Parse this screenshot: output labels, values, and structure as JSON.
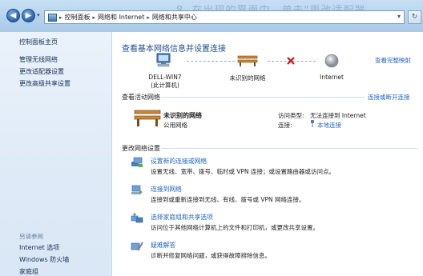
{
  "window": {
    "background_overlay_text": "8. 在出现的界面中，单击\"更改适配器"
  },
  "address_bar": {
    "segments": [
      "控制面板",
      "网络和 Internet",
      "网络和共享中心"
    ],
    "separator": "▸",
    "end_glyph": "▾",
    "refresh_glyph": "↻"
  },
  "nav": {
    "back_glyph": "◀",
    "forward_glyph": "▶",
    "drop_glyph": "▾"
  },
  "sidebar": {
    "items": [
      {
        "label": "控制面板主页"
      },
      {
        "label": "管理无线网络"
      },
      {
        "label": "更改适配器设置"
      },
      {
        "label": "更改高级共享设置"
      }
    ],
    "see_also_heading": "另请参阅",
    "see_also_items": [
      {
        "label": "Internet 选项"
      },
      {
        "label": "Windows 防火墙"
      },
      {
        "label": "家庭组"
      }
    ]
  },
  "main": {
    "title": "查看基本网络信息并设置连接",
    "view_full_map": "查看完整映射",
    "map_nodes": [
      {
        "label": "DELL-WIN7",
        "sublabel": "(此计算机)"
      },
      {
        "label": "未识别的网络",
        "sublabel": ""
      },
      {
        "label": "Internet",
        "sublabel": ""
      }
    ],
    "active_networks_label": "查看活动网络",
    "connect_disconnect": "连接或断开连接",
    "network": {
      "name": "未识别的网络",
      "type": "公用网络",
      "access_type_label": "访问类型:",
      "access_type_value": "无法连接到 Internet",
      "connections_label": "连接:",
      "connections_value": "本地连接"
    },
    "change_settings_label": "更改网络设置",
    "tasks": [
      {
        "title": "设置新的连接或网络",
        "desc": "设置无线、宽带、拨号、临时或 VPN 连接；或设置路由器或访问点。"
      },
      {
        "title": "连接到网络",
        "desc": "连接到或重新连接到无线、有线、拨号或 VPN 网络连接。"
      },
      {
        "title": "选择家庭组和共享选项",
        "desc": "访问位于其他网络计算机上的文件和打印机，或更改共享设置。"
      },
      {
        "title": "疑难解答",
        "desc": "诊断并修复网络问题，或获得故障排除信息。"
      }
    ]
  },
  "colors": {
    "accent": "#1e65c0",
    "title_blue": "#1f4c8c",
    "sidebar_bg": "#e3edf8",
    "error_red": "#d01010"
  }
}
